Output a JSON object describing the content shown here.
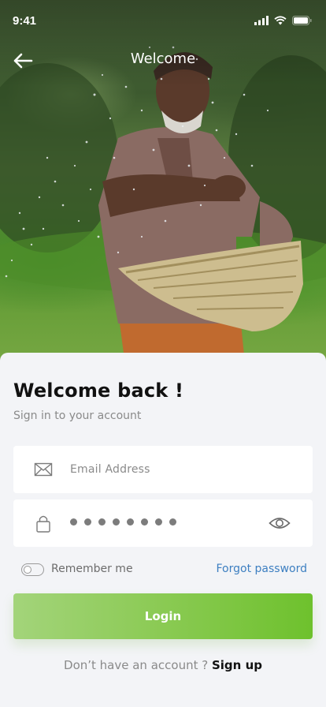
{
  "status_bar": {
    "time": "9:41"
  },
  "nav": {
    "title": "Welcome"
  },
  "login": {
    "heading": "Welcome back !",
    "subheading": "Sign in to your account",
    "email_placeholder": "Email Address",
    "remember_label": "Remember me",
    "remember_on": false,
    "forgot_label": "Forgot password",
    "button_label": "Login",
    "signup_prompt": "Don’t have an account ?",
    "signup_link": "Sign up"
  },
  "icons": {
    "back": "back-arrow-icon",
    "email": "envelope-icon",
    "password": "lock-icon",
    "visibility": "eye-icon",
    "signal": "signal-icon",
    "wifi": "wifi-icon",
    "battery": "battery-icon"
  },
  "colors": {
    "accent_green": "#6ec12d",
    "link_blue": "#3d7fc1",
    "background": "#f3f4f7"
  }
}
